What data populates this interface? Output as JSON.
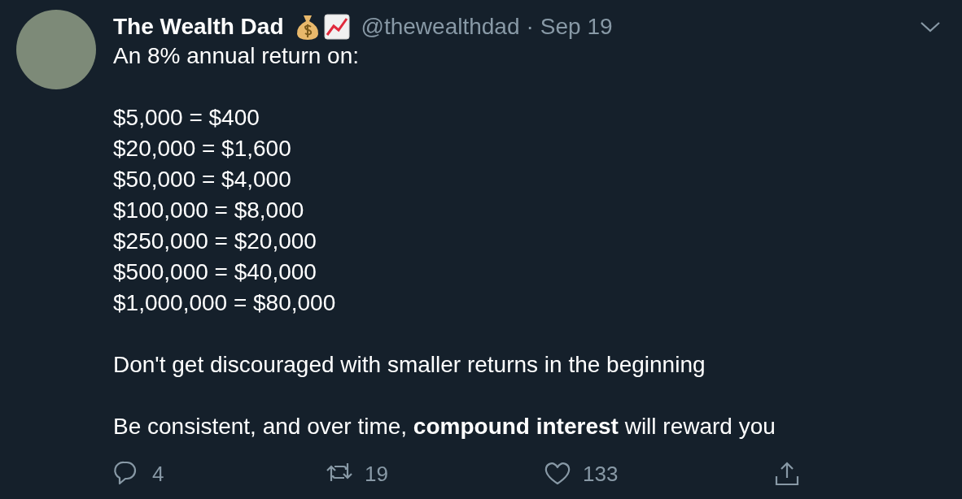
{
  "tweet": {
    "author": {
      "name": "The Wealth Dad",
      "handle": "@thewealthdad",
      "separator": "·",
      "date": "Sep 19"
    },
    "paragraphs": [
      [
        "An 8% annual return on:"
      ],
      [
        "$5,000 = $400",
        "$20,000 = $1,600",
        "$50,000 = $4,000",
        "$100,000 = $8,000",
        "$250,000 = $20,000",
        "$500,000 = $40,000",
        "$1,000,000 = $80,000"
      ],
      [
        "Don't get discouraged with smaller returns in the beginning"
      ],
      [
        "Be consistent, and over time, **compound interest** will reward you"
      ]
    ],
    "actions": [
      {
        "kind": "reply",
        "count": "4"
      },
      {
        "kind": "retweet",
        "count": "19"
      },
      {
        "kind": "like",
        "count": "133"
      },
      {
        "kind": "share"
      }
    ]
  }
}
